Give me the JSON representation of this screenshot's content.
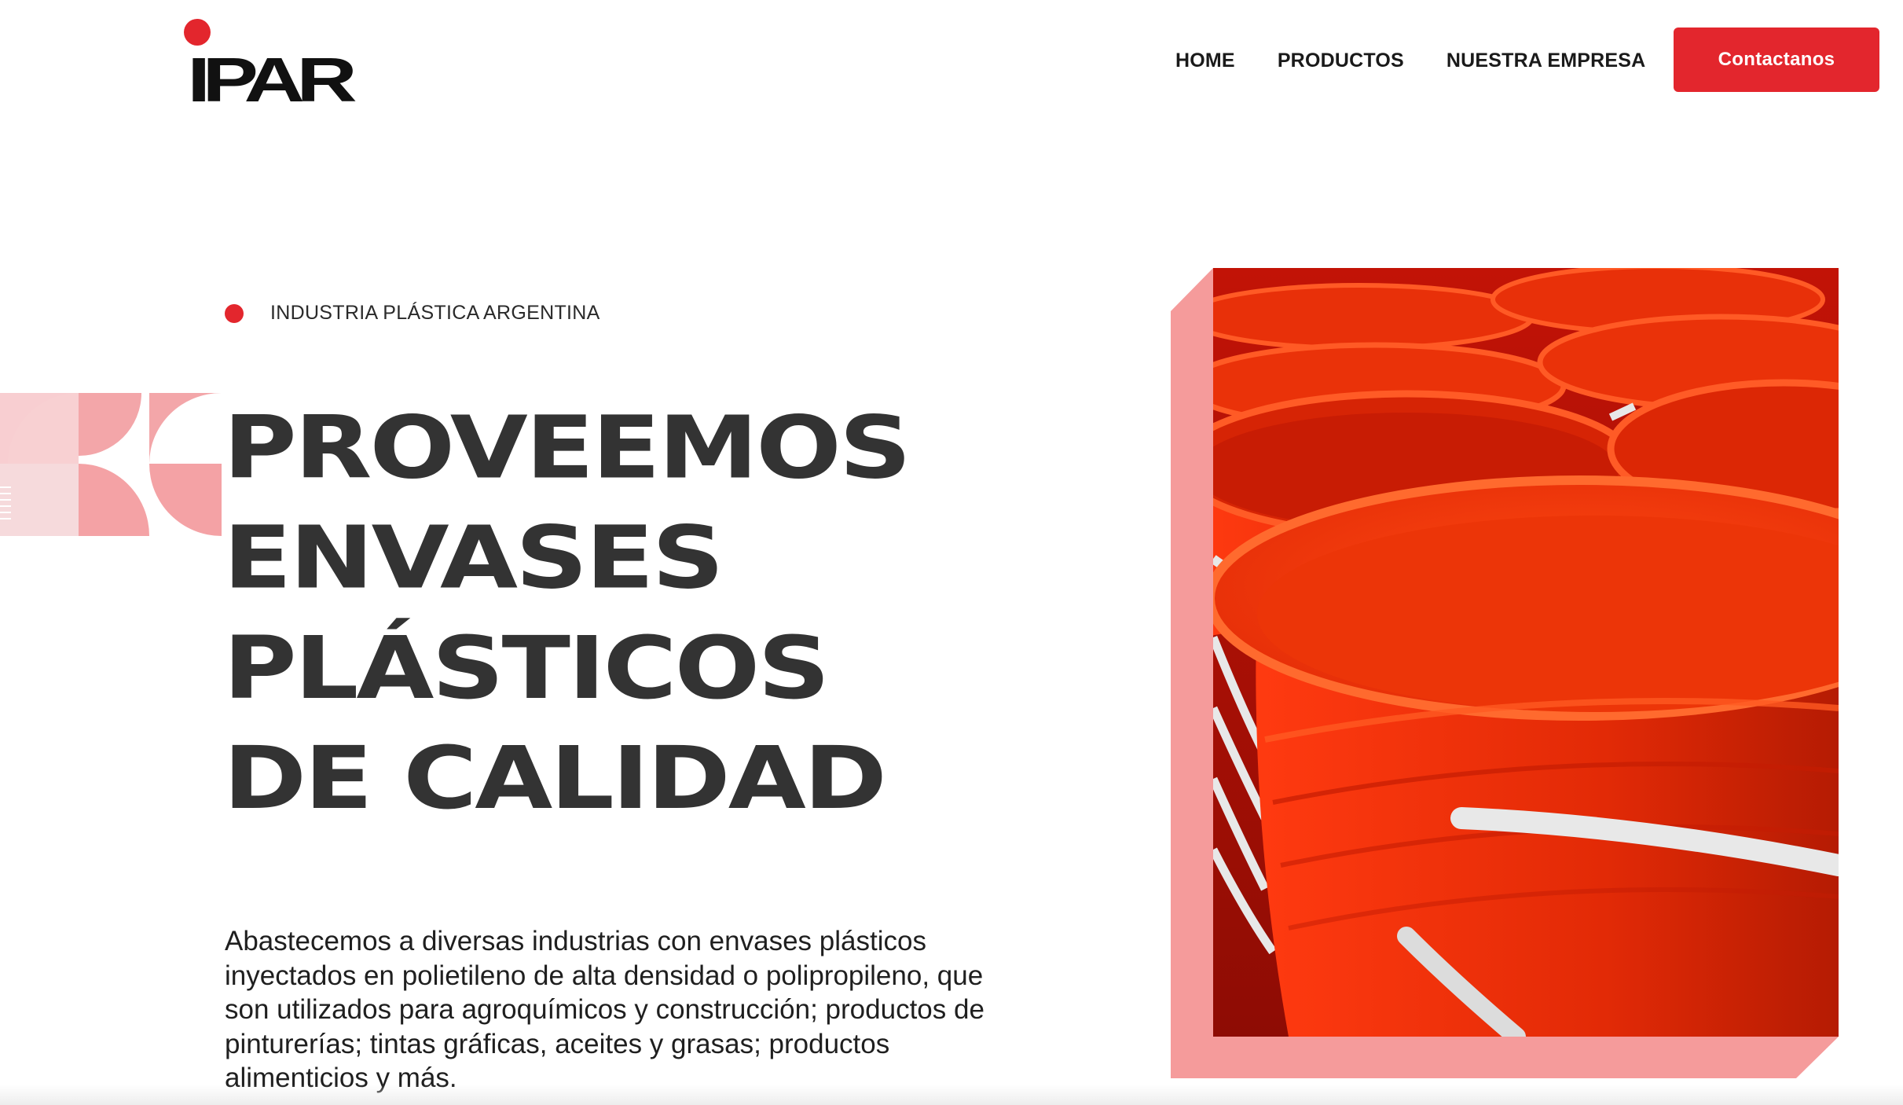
{
  "brand": {
    "logo_text": "IPAR",
    "accent_color": "#e3262d",
    "text_color": "#333333",
    "soft_pink": "#f59b9b"
  },
  "nav": {
    "items": [
      {
        "label": "HOME"
      },
      {
        "label": "PRODUCTOS"
      },
      {
        "label": "NUESTRA EMPRESA"
      }
    ],
    "cta_label": "Contactanos"
  },
  "hero": {
    "eyebrow": "INDUSTRIA PLÁSTICA ARGENTINA",
    "headline_lines": [
      "PROVEEMOS",
      "ENVASES",
      "PLÁSTICOS",
      "DE CALIDAD"
    ],
    "intro": "Abastecemos a diversas industrias con envases plásticos inyectados en polietileno de alta densidad o polipropileno, que son utilizados para agroquímicos y construcción; productos de pinturerías; tintas gráficas, aceites y grasas; productos alimenticios y más.",
    "image_subject": "red plastic buckets"
  }
}
